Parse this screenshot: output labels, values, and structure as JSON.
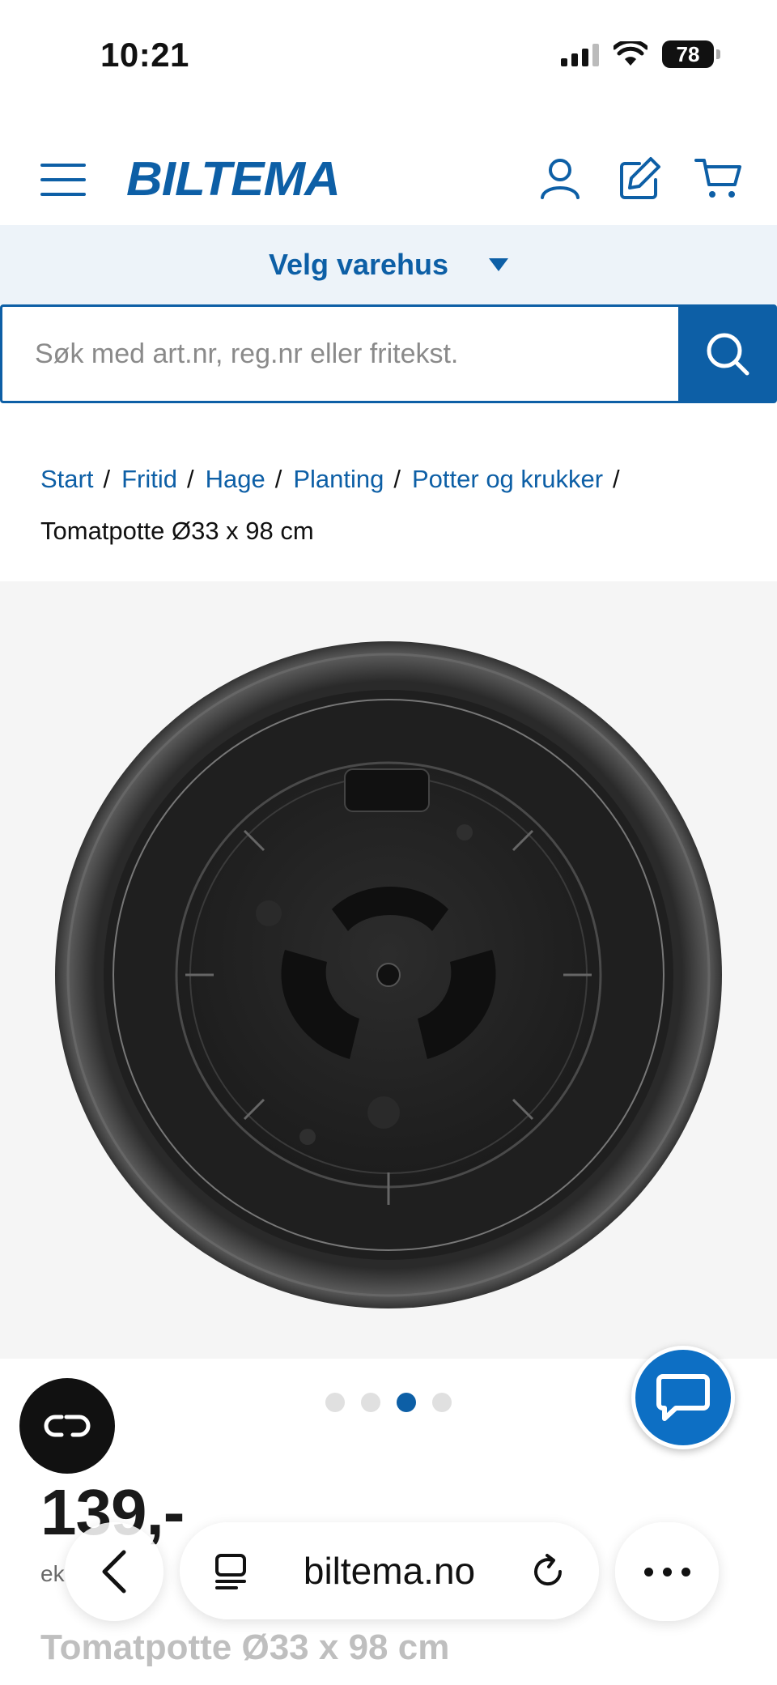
{
  "status": {
    "time": "10:21",
    "battery": "78"
  },
  "header": {
    "logo": "BILTEMA",
    "icons": [
      "menu-icon",
      "user-icon",
      "edit-icon",
      "cart-icon"
    ]
  },
  "store": {
    "label": "Velg varehus"
  },
  "search": {
    "placeholder": "Søk med art.nr, reg.nr eller fritekst."
  },
  "breadcrumb": {
    "items": [
      "Start",
      "Fritid",
      "Hage",
      "Planting",
      "Potter og krukker"
    ],
    "separator": "/",
    "current": "Tomatpotte Ø33 x 98 cm"
  },
  "gallery": {
    "slide_count": 4,
    "active_index": 2
  },
  "product": {
    "price": "139,-",
    "price_note": "ek",
    "title": "Tomatpotte Ø33 x 98 cm"
  },
  "browser": {
    "url": "biltema.no"
  },
  "colors": {
    "brand": "#0d5fa6",
    "store_bar_bg": "#edf3f9",
    "chat_button": "#0d6fc4"
  }
}
